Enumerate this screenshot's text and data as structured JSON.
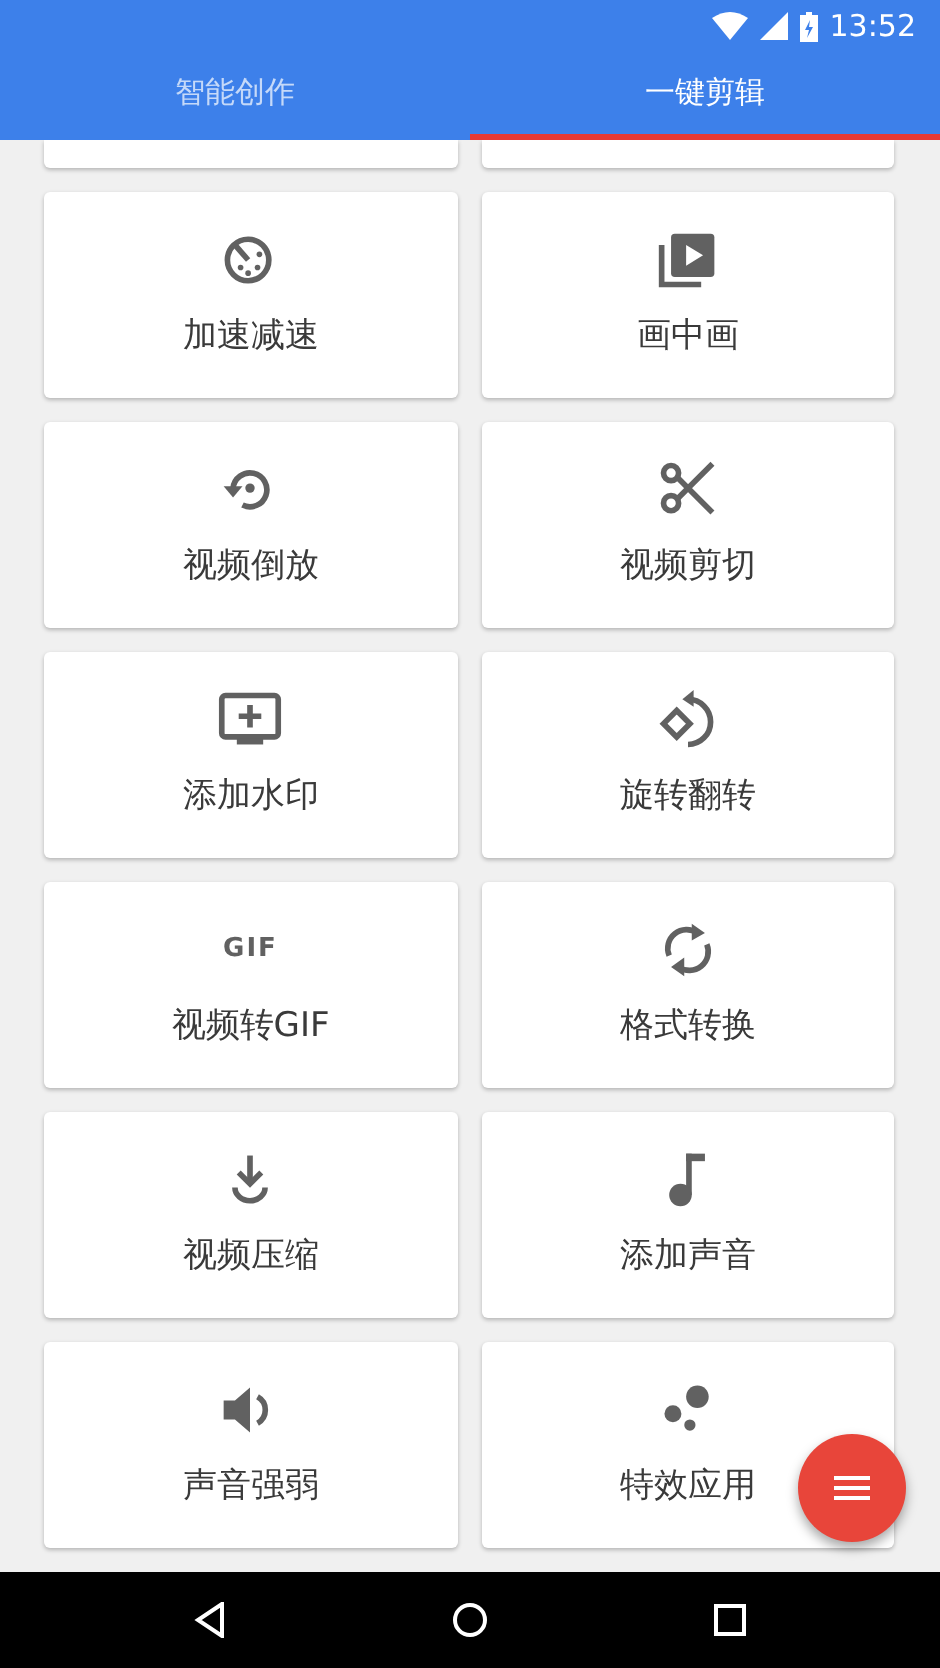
{
  "status_bar": {
    "time": "13:52"
  },
  "tabs": [
    {
      "label": "智能创作",
      "selected": false
    },
    {
      "label": "一键剪辑",
      "selected": true
    }
  ],
  "tools": [
    {
      "label": "加速减速"
    },
    {
      "label": "画中画"
    },
    {
      "label": "视频倒放"
    },
    {
      "label": "视频剪切"
    },
    {
      "label": "添加水印"
    },
    {
      "label": "旋转翻转"
    },
    {
      "label": "视频转GIF",
      "icon_text": "GIF"
    },
    {
      "label": "格式转换"
    },
    {
      "label": "视频压缩"
    },
    {
      "label": "添加声音"
    },
    {
      "label": "声音强弱"
    },
    {
      "label": "特效应用"
    }
  ]
}
